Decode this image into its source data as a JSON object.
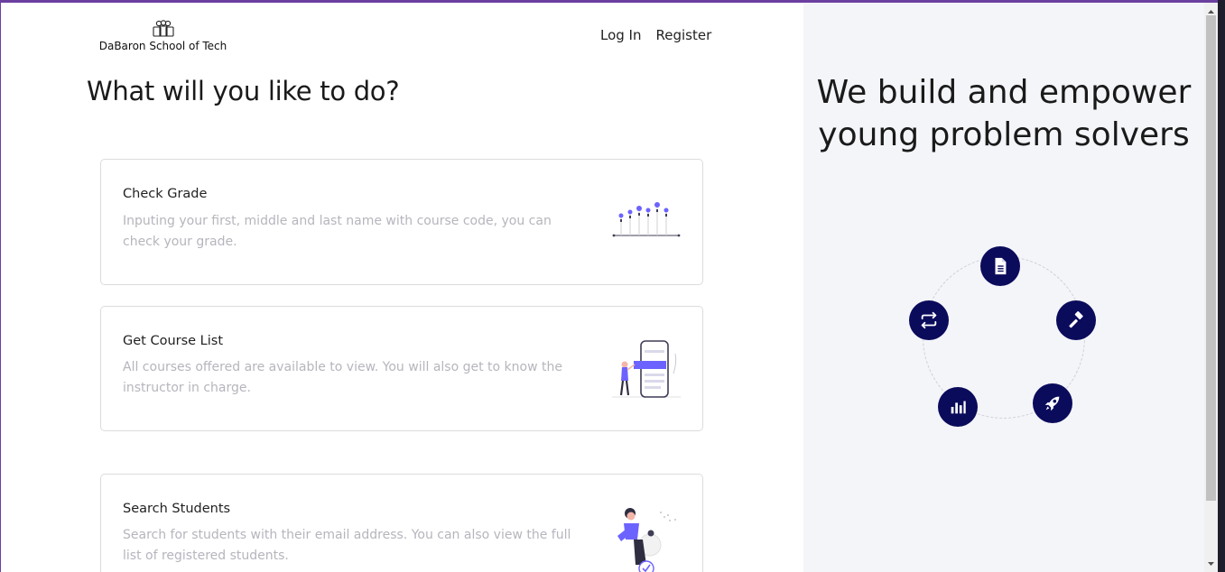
{
  "header": {
    "brand_name": "DaBaron School of Tech",
    "brand_icon": "students-group-icon",
    "nav": {
      "login": "Log In",
      "register": "Register"
    }
  },
  "main": {
    "title": "What will you like to do?",
    "cards": [
      {
        "title": "Check Grade",
        "description": "Inputing your first, middle and last name with course code, you can check your grade.",
        "illustration": "grade-chart-illustration"
      },
      {
        "title": "Get Course List",
        "description": "All courses offered are available to view. You will also get to know the instructor in charge.",
        "illustration": "course-list-phone-illustration"
      },
      {
        "title": "Search Students",
        "description": "Search for students with their email address. You can also view the full list of registered students.",
        "illustration": "search-students-illustration"
      }
    ]
  },
  "aside": {
    "tagline": "We build and empower young problem solvers",
    "orbit_icons": [
      "document-icon",
      "hammer-icon",
      "rocket-icon",
      "bar-chart-icon",
      "swap-arrows-icon"
    ]
  },
  "colors": {
    "accent": "#6b3fa0",
    "node": "#0b0b5c",
    "panel_bg": "#f4f5f9",
    "illustration_purple": "#6c63ff"
  }
}
